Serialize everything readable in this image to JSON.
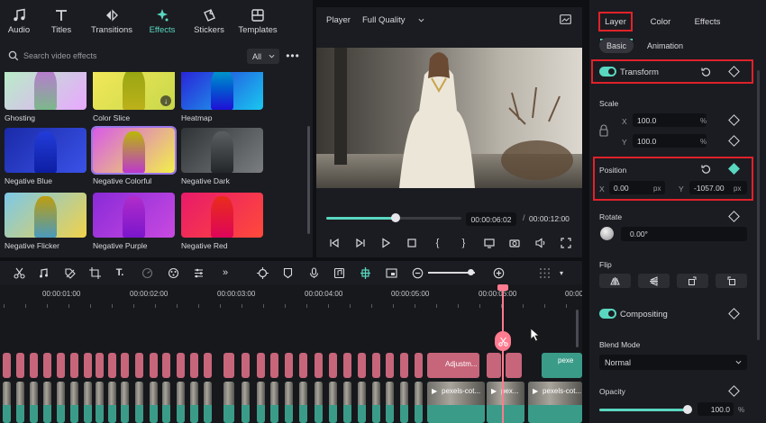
{
  "categories": [
    {
      "label": "Audio",
      "icon": "music-note-icon"
    },
    {
      "label": "Titles",
      "icon": "title-t-icon"
    },
    {
      "label": "Transitions",
      "icon": "transition-arrows-icon"
    },
    {
      "label": "Effects",
      "icon": "sparkle-icon",
      "active": true
    },
    {
      "label": "Stickers",
      "icon": "sticker-icon"
    },
    {
      "label": "Templates",
      "icon": "template-icon"
    }
  ],
  "search": {
    "placeholder": "Search video effects",
    "filter_value": "All"
  },
  "effects": [
    {
      "label": "Ghosting",
      "colors": [
        "#b6f0c4",
        "#e8a8ff"
      ]
    },
    {
      "label": "Color Slice",
      "colors": [
        "#f4e95a",
        "#c8d84a"
      ],
      "download": true
    },
    {
      "label": "Heatmap",
      "colors": [
        "#2a1bd8",
        "#19c8f0"
      ]
    },
    {
      "label": "Negative Blue",
      "colors": [
        "#1a2aa8",
        "#3a52e8"
      ]
    },
    {
      "label": "Negative Colorful",
      "colors": [
        "#d85ae8",
        "#f2f04a"
      ],
      "selected": true
    },
    {
      "label": "Negative Dark",
      "colors": [
        "#2f3336",
        "#7a7e80"
      ]
    },
    {
      "label": "Negative Flicker",
      "colors": [
        "#7cc8e8",
        "#f0d24a"
      ]
    },
    {
      "label": "Negative Purple",
      "colors": [
        "#8a2ad8",
        "#c84ae0"
      ]
    },
    {
      "label": "Negative Red",
      "colors": [
        "#e81a6a",
        "#ff4a3a"
      ]
    }
  ],
  "player": {
    "label": "Player",
    "quality": "Full Quality",
    "current_time": "00:00:06:02",
    "separator": "/",
    "total_time": "00:00:12:00",
    "progress": 0.51
  },
  "props": {
    "tabs": [
      "Layer",
      "Color",
      "Effects"
    ],
    "active_tab": "Layer",
    "subtabs": [
      "Basic",
      "Animation"
    ],
    "active_subtab": "Basic",
    "transform_title": "Transform",
    "scale_title": "Scale",
    "scale_x": "100.0",
    "scale_y": "100.0",
    "scale_unit": "%",
    "position_title": "Position",
    "pos_x": "0.00",
    "pos_y": "-1057.00",
    "pos_unit": "px",
    "rotate_title": "Rotate",
    "rotate_value": "0.00°",
    "flip_title": "Flip",
    "compositing_title": "Compositing",
    "blend_title": "Blend Mode",
    "blend_value": "Normal",
    "opacity_title": "Opacity",
    "opacity_value": "100.0",
    "opacity_unit": "%",
    "axis_x": "X",
    "axis_y": "Y"
  },
  "ruler": [
    "00:00:01:00",
    "00:00:02:00",
    "00:00:03:00",
    "00:00:04:00",
    "00:00:05:00",
    "00:00:06:00",
    "00:00:0"
  ],
  "clips": {
    "adjust": "Adjustm...",
    "pexels_top": "pexe",
    "pexels_a": "pexels-cot...",
    "pexels_b": "pex...",
    "pexels_c": "pexels-cot..."
  },
  "colors": {
    "accent": "#5ad7c0",
    "highlight": "#e0222a",
    "playhead": "#ff7b8f",
    "clip_pink": "#c7657a",
    "clip_green": "#3a9b88"
  }
}
